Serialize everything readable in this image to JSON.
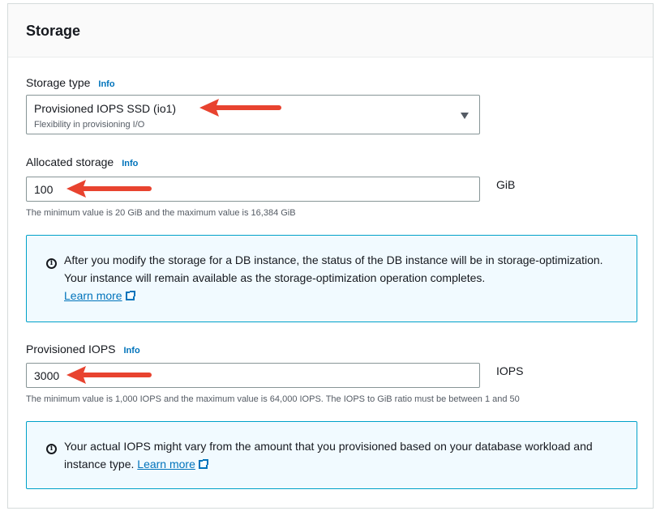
{
  "panel": {
    "title": "Storage"
  },
  "storage_type": {
    "label": "Storage type",
    "info": "Info",
    "selected": "Provisioned IOPS SSD (io1)",
    "description": "Flexibility in provisioning I/O"
  },
  "allocated_storage": {
    "label": "Allocated storage",
    "info": "Info",
    "value": "100",
    "unit": "GiB",
    "constraint": "The minimum value is 20 GiB and the maximum value is 16,384 GiB"
  },
  "storage_alert": {
    "text": "After you modify the storage for a DB instance, the status of the DB instance will be in storage-optimization. Your instance will remain available as the storage-optimization operation completes.",
    "link": "Learn more"
  },
  "provisioned_iops": {
    "label": "Provisioned IOPS",
    "info": "Info",
    "value": "3000",
    "unit": "IOPS",
    "constraint": "The minimum value is 1,000 IOPS and the maximum value is 64,000 IOPS. The IOPS to GiB ratio must be between 1 and 50"
  },
  "iops_alert": {
    "text": "Your actual IOPS might vary from the amount that you provisioned based on your database workload and instance type.",
    "link": "Learn more"
  },
  "colors": {
    "annotation_arrow": "#e8432f",
    "link": "#0073bb",
    "alert_border": "#00a1c9",
    "alert_background": "#f1faff"
  }
}
